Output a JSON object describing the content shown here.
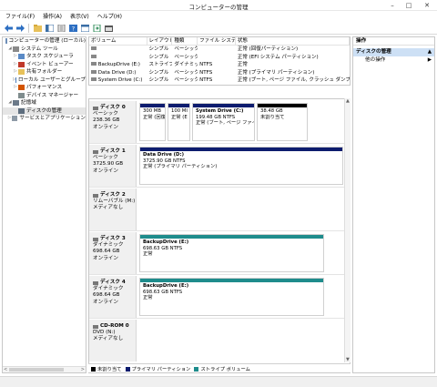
{
  "window": {
    "title": "コンピューターの管理",
    "min_label": "–",
    "max_label": "□",
    "close_label": "✕"
  },
  "menu": [
    "ファイル(F)",
    "操作(A)",
    "表示(V)",
    "ヘルプ(H)"
  ],
  "toolbar_icons": [
    "back-arrow-icon",
    "forward-arrow-icon",
    "folder-up-icon",
    "console-tree-icon",
    "properties-icon",
    "help-icon",
    "list-view-icon",
    "export-icon",
    "new-window-icon"
  ],
  "tree": {
    "items": [
      {
        "label": "コンピューターの管理 (ローカル)",
        "level": 0,
        "exp": ""
      },
      {
        "label": "システム ツール",
        "level": 1,
        "exp": "◢"
      },
      {
        "label": "タスク スケジューラ",
        "level": 2,
        "exp": "▷"
      },
      {
        "label": "イベント ビューアー",
        "level": 2,
        "exp": "▷"
      },
      {
        "label": "共有フォルダー",
        "level": 2,
        "exp": "▷"
      },
      {
        "label": "ローカル ユーザーとグループ",
        "level": 2,
        "exp": "▷"
      },
      {
        "label": "パフォーマンス",
        "level": 2,
        "exp": "▷"
      },
      {
        "label": "デバイス マネージャー",
        "level": 2,
        "exp": ""
      },
      {
        "label": "記憶域",
        "level": 1,
        "exp": "◢"
      },
      {
        "label": "ディスクの管理",
        "level": 2,
        "exp": ""
      },
      {
        "label": "サービスとアプリケーション",
        "level": 1,
        "exp": "▷"
      }
    ],
    "scroll_left": "<",
    "scroll_right": ">"
  },
  "volumes": {
    "headers": [
      "ボリューム",
      "レイアウト",
      "種類",
      "ファイル システム",
      "状態"
    ],
    "rows": [
      [
        "",
        "シンプル",
        "ベーシック",
        "",
        "正常 (回復パーティション)"
      ],
      [
        "",
        "シンプル",
        "ベーシック",
        "",
        "正常 (EFI システム パーティション)"
      ],
      [
        "BackupDrive (E:)",
        "ストライプ",
        "ダイナミック",
        "NTFS",
        "正常"
      ],
      [
        "Data Drive (D:)",
        "シンプル",
        "ベーシック",
        "NTFS",
        "正常 (プライマリ パーティション)"
      ],
      [
        "System Drive (C:)",
        "シンプル",
        "ベーシック",
        "NTFS",
        "正常 (ブート, ページ ファイル, クラッシュ ダンプ, プライ"
      ]
    ]
  },
  "disks": [
    {
      "name": "ディスク 0",
      "type": "ベーシック",
      "size": "238.36 GB",
      "status": "オンライン",
      "partitions": [
        {
          "title": "",
          "size": "300 MB",
          "status": "正常 (回復",
          "color": "#0d1c6e"
        },
        {
          "title": "",
          "size": "100 MI",
          "status": "正常 (E",
          "color": "#0d1c6e"
        },
        {
          "title": "System Drive  (C:)",
          "size": "199.48 GB NTFS",
          "status": "正常 (ブート, ページ ファイ",
          "color": "#0d1c6e"
        },
        {
          "title": "",
          "size": "38.48 GB",
          "status": "未割り当て",
          "color": "#000000"
        }
      ]
    },
    {
      "name": "ディスク 1",
      "type": "ベーシック",
      "size": "3725.90 GB",
      "status": "オンライン",
      "partitions": [
        {
          "title": "Data Drive  (D:)",
          "size": "3725.90 GB NTFS",
          "status": "正常 (プライマリ パーティション)",
          "color": "#0d1c6e"
        }
      ]
    },
    {
      "name": "ディスク 2",
      "type": "リムーバブル (M:)",
      "size": "",
      "status": "メディアなし",
      "partitions": []
    },
    {
      "name": "ディスク 3",
      "type": "ダイナミック",
      "size": "698.64 GB",
      "status": "オンライン",
      "partitions": [
        {
          "title": "BackupDrive  (E:)",
          "size": "698.63 GB NTFS",
          "status": "正常",
          "color": "#1e8c8c"
        }
      ]
    },
    {
      "name": "ディスク 4",
      "type": "ダイナミック",
      "size": "698.64 GB",
      "status": "オンライン",
      "partitions": [
        {
          "title": "BackupDrive  (E:)",
          "size": "698.63 GB NTFS",
          "status": "正常",
          "color": "#1e8c8c"
        }
      ]
    },
    {
      "name": "CD-ROM 0",
      "type": "DVD (N:)",
      "size": "",
      "status": "メディアなし",
      "partitions": []
    }
  ],
  "legend": [
    {
      "label": "未割り当て",
      "color": "#000000"
    },
    {
      "label": "プライマリ パーティション",
      "color": "#0d1c6e"
    },
    {
      "label": "ストライプ ボリューム",
      "color": "#1e8c8c"
    }
  ],
  "actions": {
    "header": "操作",
    "group": "ディスクの管理",
    "group_arrow": "▲",
    "item": "他の操作",
    "item_arrow": "▶"
  }
}
